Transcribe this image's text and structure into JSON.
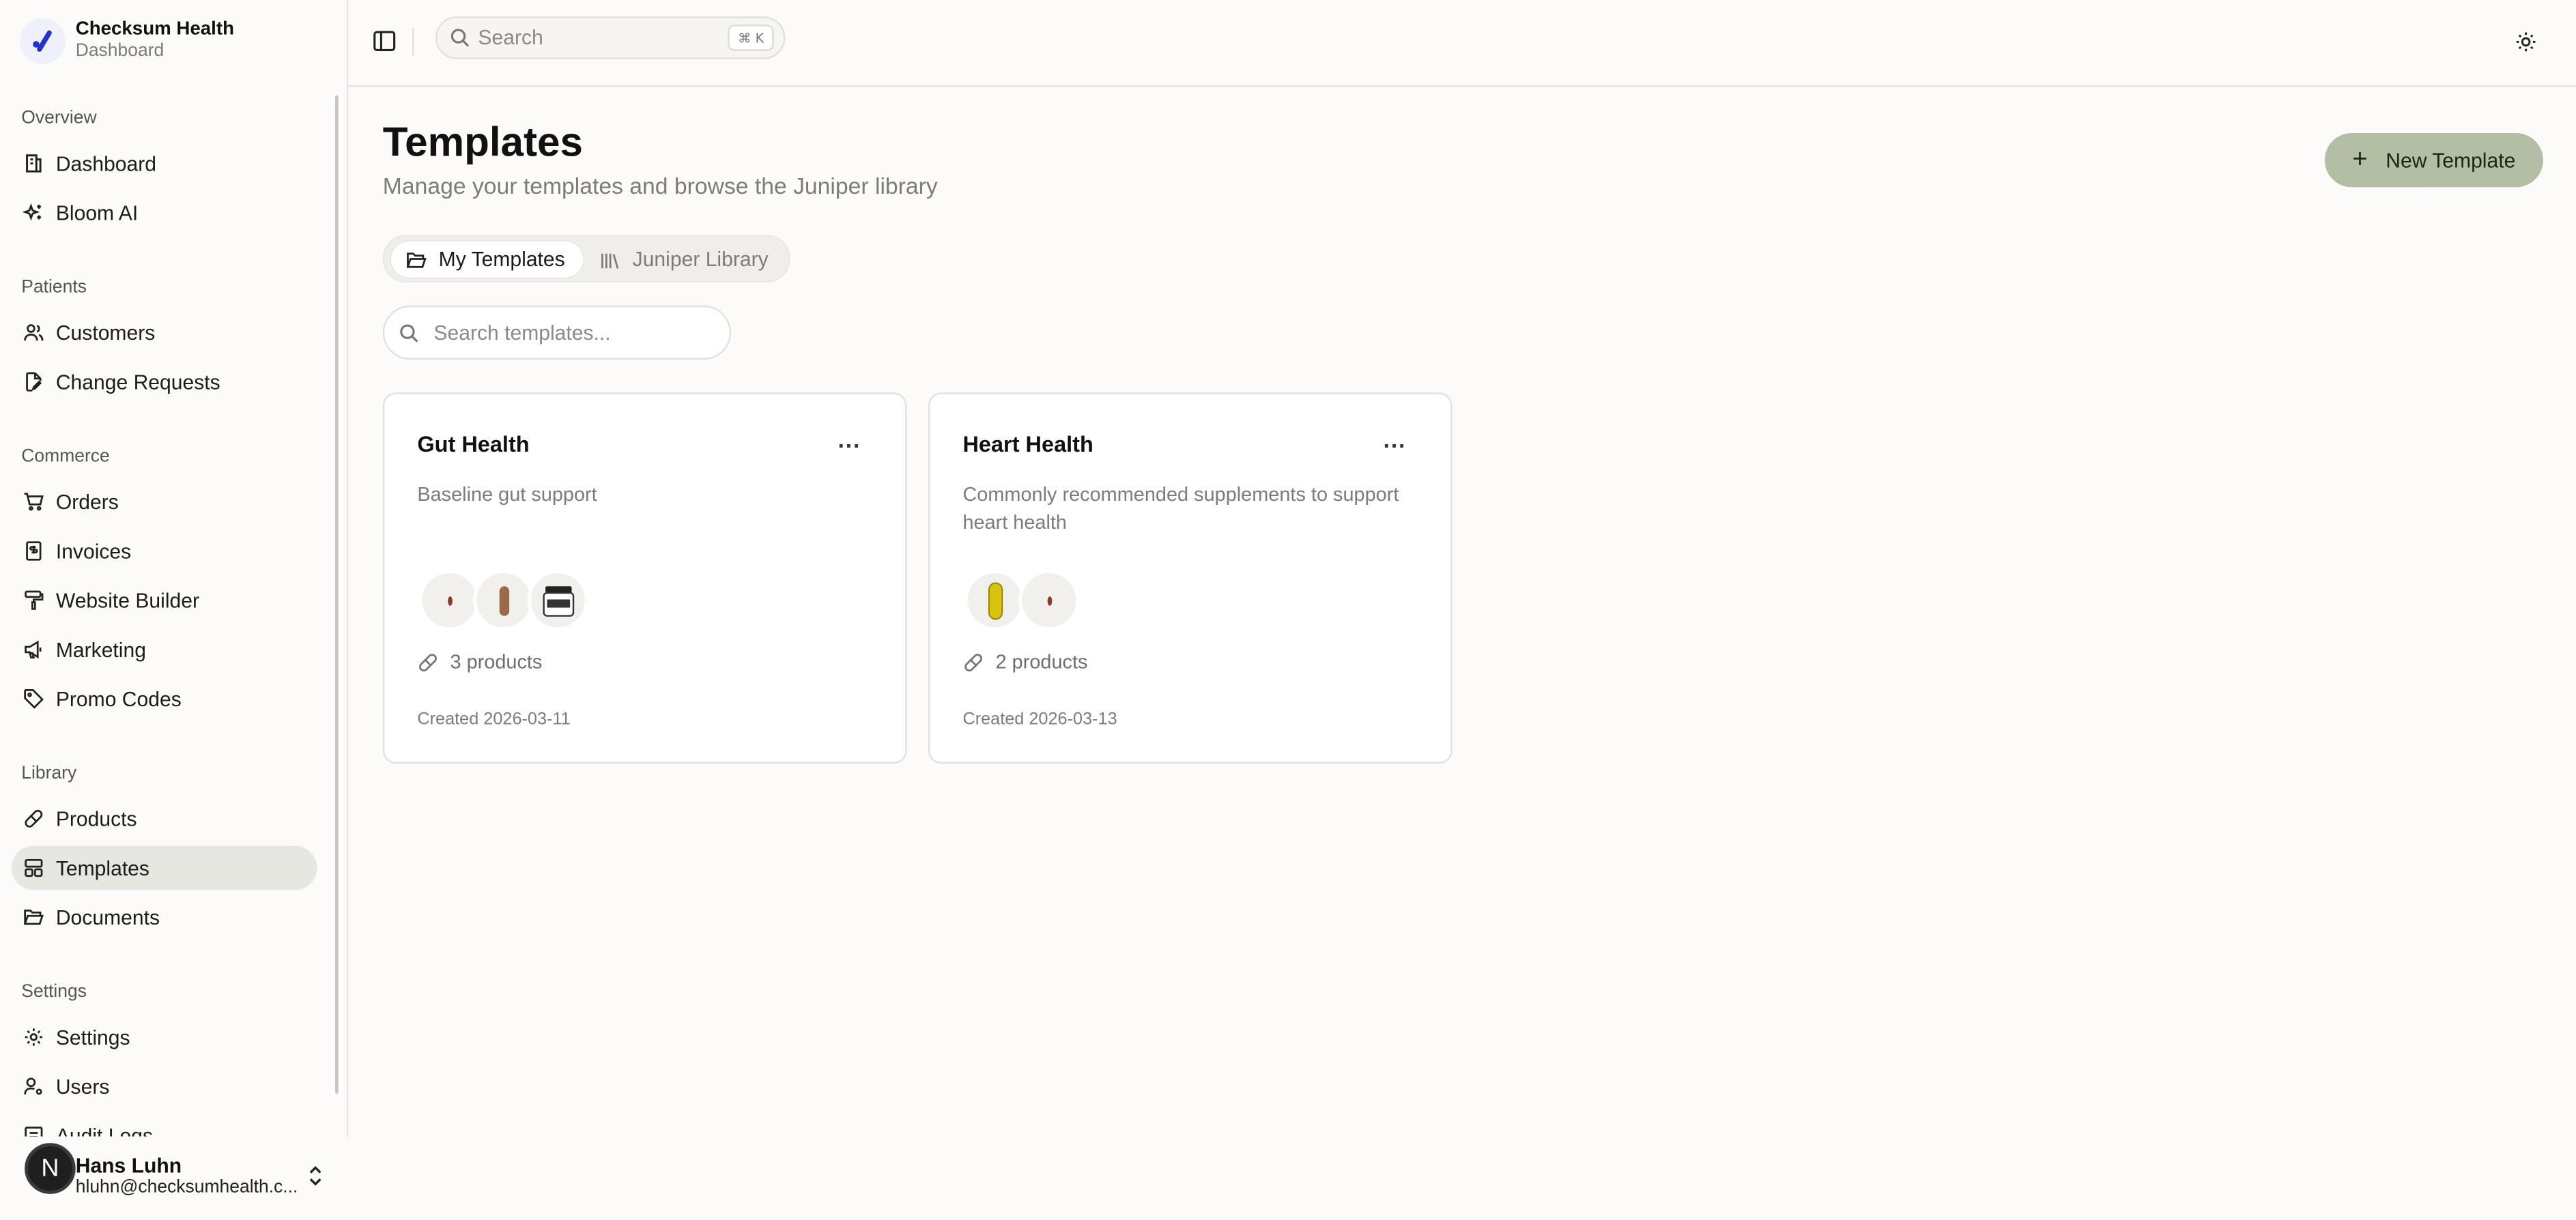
{
  "brand": {
    "title": "Checksum Health",
    "subtitle": "Dashboard"
  },
  "sidebar": {
    "groups": [
      {
        "label": "Overview",
        "items": [
          {
            "label": "Dashboard"
          },
          {
            "label": "Bloom AI"
          }
        ]
      },
      {
        "label": "Patients",
        "items": [
          {
            "label": "Customers"
          },
          {
            "label": "Change Requests"
          }
        ]
      },
      {
        "label": "Commerce",
        "items": [
          {
            "label": "Orders"
          },
          {
            "label": "Invoices"
          },
          {
            "label": "Website Builder"
          },
          {
            "label": "Marketing"
          },
          {
            "label": "Promo Codes"
          }
        ]
      },
      {
        "label": "Library",
        "items": [
          {
            "label": "Products"
          },
          {
            "label": "Templates"
          },
          {
            "label": "Documents"
          }
        ]
      },
      {
        "label": "Settings",
        "items": [
          {
            "label": "Settings"
          },
          {
            "label": "Users"
          },
          {
            "label": "Audit Logs"
          }
        ]
      }
    ],
    "active_item": "Templates"
  },
  "user": {
    "initial": "N",
    "name": "Hans Luhn",
    "email": "hluhn@checksumhealth.c..."
  },
  "topbar": {
    "search_placeholder": "Search",
    "shortcut": "⌘ K"
  },
  "page": {
    "title": "Templates",
    "subtitle": "Manage your templates and browse the Juniper library",
    "new_button": "New Template",
    "tabs": [
      {
        "label": "My Templates",
        "active": true
      },
      {
        "label": "Juniper Library",
        "active": false
      }
    ],
    "search_placeholder": "Search templates..."
  },
  "templates": [
    {
      "title": "Gut Health",
      "description": "Baseline gut support",
      "products_label": "3 products",
      "created": "Created 2026-03-11",
      "thumbnails": [
        "capsule-small-icon",
        "capsule-brown-icon",
        "jar-icon"
      ]
    },
    {
      "title": "Heart Health",
      "description": "Commonly recommended supplements to support heart health",
      "products_label": "2 products",
      "created": "Created 2026-03-13",
      "thumbnails": [
        "softgel-yellow-icon",
        "capsule-small-icon"
      ]
    }
  ],
  "colors": {
    "accent_button": "#b3bea4",
    "active_nav": "#e6e7e1",
    "brand_logo": "#2633c9"
  }
}
